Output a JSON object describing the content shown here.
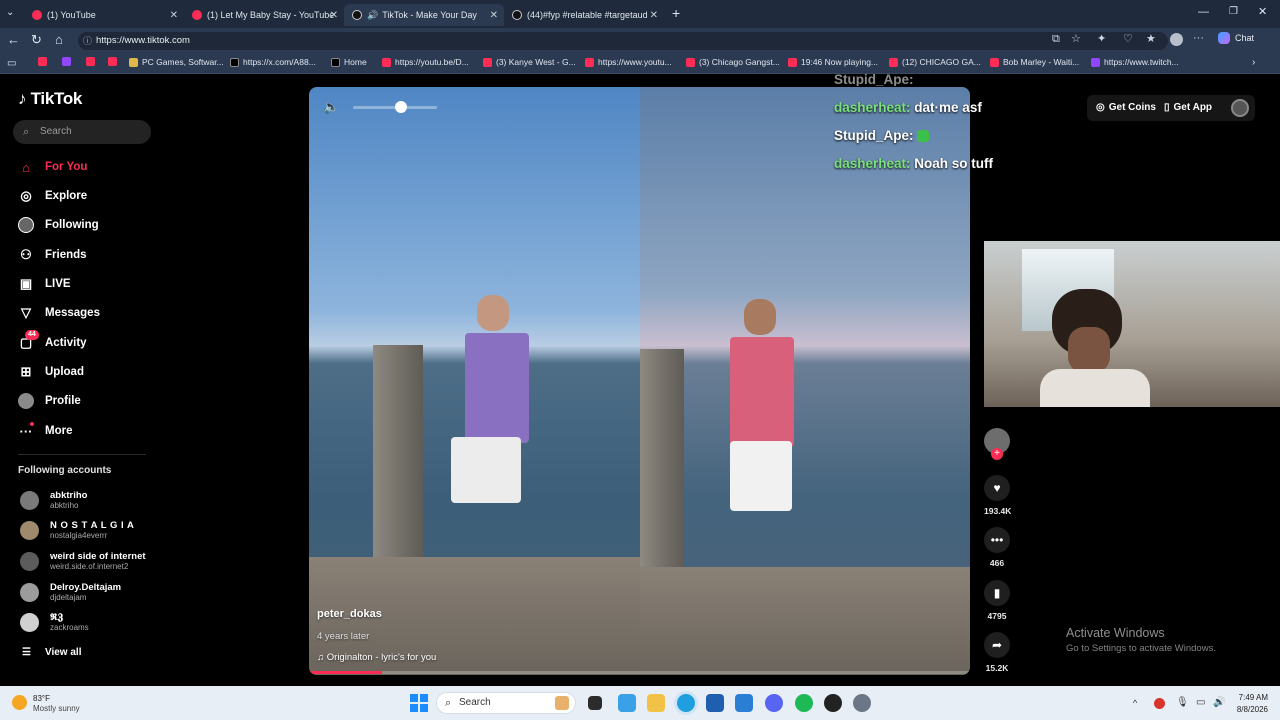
{
  "browser": {
    "tabs": [
      {
        "title": "(1) YouTube",
        "favicon": "youtube-icon"
      },
      {
        "title": "(1) Let My Baby Stay - YouTube",
        "favicon": "youtube-icon"
      },
      {
        "title": "TikTok - Make Your Day",
        "favicon": "tiktok-icon",
        "active": true
      },
      {
        "title": "(44)#fyp #relatable #targetaudien",
        "favicon": "tiktok-icon"
      }
    ],
    "url": "https://www.tiktok.com",
    "chat_label": "Chat",
    "bookmarks": [
      "PC Games, Softwar...",
      "https://x.com/A88...",
      "Home",
      "https://youtu.be/D...",
      "(3) Kanye West - G...",
      "https://www.youtu...",
      "(3) Chicago Gangst...",
      "19:46 Now playing...",
      "(12) CHICAGO GA...",
      "Bob Marley - Waiti...",
      "https://www.twitch..."
    ]
  },
  "sidebar": {
    "logo": "TikTok",
    "search_placeholder": "Search",
    "nav": [
      {
        "label": "For You",
        "icon": "home-icon",
        "active": true
      },
      {
        "label": "Explore",
        "icon": "compass-icon"
      },
      {
        "label": "Following",
        "icon": "following-icon"
      },
      {
        "label": "Friends",
        "icon": "friends-icon"
      },
      {
        "label": "LIVE",
        "icon": "live-icon"
      },
      {
        "label": "Messages",
        "icon": "messages-icon"
      },
      {
        "label": "Activity",
        "icon": "activity-icon",
        "badge": "44"
      },
      {
        "label": "Upload",
        "icon": "upload-icon"
      },
      {
        "label": "Profile",
        "icon": "profile-icon"
      },
      {
        "label": "More",
        "icon": "more-icon"
      }
    ],
    "following_header": "Following accounts",
    "accounts": [
      {
        "name": "abktriho",
        "handle": "abktriho"
      },
      {
        "name": "N O S T A L G I A",
        "handle": "nostalgia4everrr"
      },
      {
        "name": "weird side of internet",
        "handle": "weird.side.of.internet2"
      },
      {
        "name": "Delroy.Deltajam",
        "handle": "djdeltajam"
      },
      {
        "name": "𝕽𝖅",
        "handle": "zackroams"
      }
    ],
    "view_all": "View all"
  },
  "video": {
    "author": "peter_dokas",
    "posted": "4 years later",
    "sound": "Originalton - lyric's for you",
    "progress": 0.11
  },
  "chat_overlay": [
    {
      "user": "Stupid_Ape:",
      "message": ""
    },
    {
      "user": "dasherheat:",
      "message": "dat·me asf"
    },
    {
      "user": "Stupid_Ape:",
      "message": ""
    },
    {
      "user": "dasherheat:",
      "message": "Noah so tuff"
    }
  ],
  "header_buttons": {
    "coins": "Get Coins",
    "app": "Get App"
  },
  "actions": {
    "likes": "193.4K",
    "comments": "466",
    "saves": "4795",
    "shares": "15.2K"
  },
  "watermark": {
    "title": "Activate Windows",
    "subtitle": "Go to Settings to activate Windows."
  },
  "taskbar": {
    "weather_temp": "83°F",
    "weather_desc": "Mostly sunny",
    "search": "Search",
    "time": "7:49 AM",
    "date": "8/8/2026"
  },
  "colors": {
    "accent": "#fe2c55",
    "chat_user": "#79e07b",
    "chrome": "#2c3a51"
  }
}
